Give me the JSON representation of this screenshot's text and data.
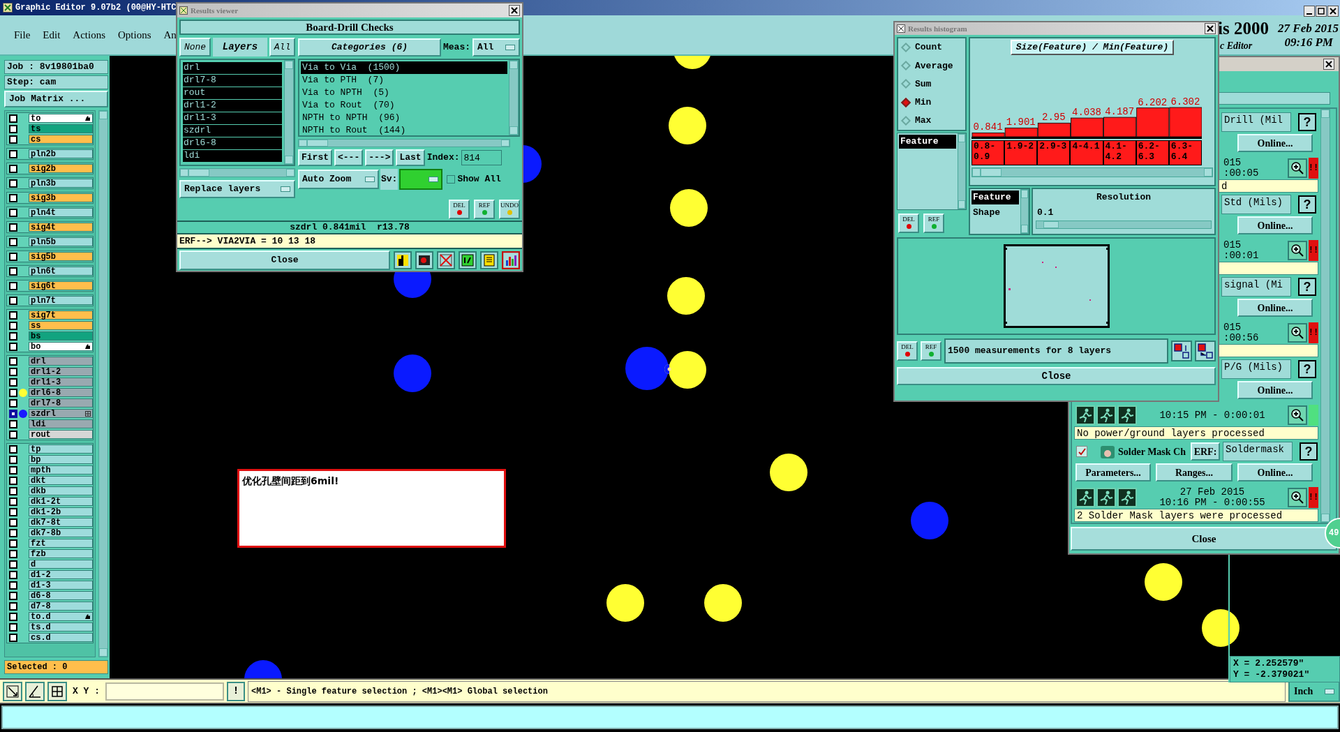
{
  "app": {
    "title": "Graphic Editor 9.07b2 (00@HY-HTC",
    "menu": [
      "File",
      "Edit",
      "Actions",
      "Options",
      "An"
    ]
  },
  "header": {
    "brand": "is 2000",
    "subtitle": "c Editor",
    "date": "27 Feb 2015",
    "time": "09:16 PM"
  },
  "job_panel": {
    "job": "Job : 8v19801ba0",
    "step": "Step: cam",
    "matrix_button": "Job Matrix ...",
    "selected_count": "Selected : 0",
    "layer_groups": [
      {
        "layers": [
          {
            "name": "to",
            "color": "#ffffff",
            "selected": false,
            "flagged": true,
            "displayed": false,
            "work": false
          },
          {
            "name": "ts",
            "color": "#12a37f",
            "selected": false,
            "flagged": false,
            "displayed": false,
            "work": false
          },
          {
            "name": "cs",
            "color": "#ffbe4c",
            "selected": false,
            "flagged": false,
            "displayed": false,
            "work": false
          }
        ]
      },
      {
        "layers": [
          {
            "name": "pln2b",
            "color": "#9edcdc",
            "selected": false,
            "flagged": false,
            "displayed": false,
            "work": false
          }
        ]
      },
      {
        "layers": [
          {
            "name": "sig2b",
            "color": "#ffbe4c",
            "selected": false,
            "flagged": false,
            "displayed": false,
            "work": false
          }
        ]
      },
      {
        "layers": [
          {
            "name": "pln3b",
            "color": "#9edcdc",
            "selected": false,
            "flagged": false,
            "displayed": false,
            "work": false
          }
        ]
      },
      {
        "layers": [
          {
            "name": "sig3b",
            "color": "#ffbe4c",
            "selected": false,
            "flagged": false,
            "displayed": false,
            "work": false
          }
        ]
      },
      {
        "layers": [
          {
            "name": "pln4t",
            "color": "#9edcdc",
            "selected": false,
            "flagged": false,
            "displayed": false,
            "work": false
          }
        ]
      },
      {
        "layers": [
          {
            "name": "sig4t",
            "color": "#ffbe4c",
            "selected": false,
            "flagged": false,
            "displayed": false,
            "work": false
          }
        ]
      },
      {
        "layers": [
          {
            "name": "pln5b",
            "color": "#9edcdc",
            "selected": false,
            "flagged": false,
            "displayed": false,
            "work": false
          }
        ]
      },
      {
        "layers": [
          {
            "name": "sig5b",
            "color": "#ffbe4c",
            "selected": false,
            "flagged": false,
            "displayed": false,
            "work": false
          }
        ]
      },
      {
        "layers": [
          {
            "name": "pln6t",
            "color": "#9edcdc",
            "selected": false,
            "flagged": false,
            "displayed": false,
            "work": false
          }
        ]
      },
      {
        "layers": [
          {
            "name": "sig6t",
            "color": "#ffbe4c",
            "selected": false,
            "flagged": false,
            "displayed": false,
            "work": false
          }
        ]
      },
      {
        "layers": [
          {
            "name": "pln7t",
            "color": "#9edcdc",
            "selected": false,
            "flagged": false,
            "displayed": false,
            "work": false
          }
        ]
      },
      {
        "layers": [
          {
            "name": "sig7t",
            "color": "#ffbe4c",
            "selected": false,
            "flagged": false,
            "displayed": false,
            "work": false
          },
          {
            "name": "ss",
            "color": "#ffbe4c",
            "selected": false,
            "flagged": false,
            "displayed": false,
            "work": false
          },
          {
            "name": "bs",
            "color": "#12a37f",
            "selected": false,
            "flagged": false,
            "displayed": false,
            "work": false
          },
          {
            "name": "bo",
            "color": "#ffffff",
            "selected": false,
            "flagged": true,
            "displayed": false,
            "work": false
          }
        ]
      },
      {
        "layers": [
          {
            "name": "drl",
            "color": "#99a9b0",
            "selected": false,
            "flagged": false,
            "displayed": false,
            "work": false
          },
          {
            "name": "drl1-2",
            "color": "#99a9b0",
            "selected": false,
            "flagged": false,
            "displayed": false,
            "work": false
          },
          {
            "name": "drl1-3",
            "color": "#99a9b0",
            "selected": false,
            "flagged": false,
            "displayed": false,
            "work": false
          },
          {
            "name": "drl6-8",
            "color": "#99a9b0",
            "selected": false,
            "flagged": false,
            "displayed": true,
            "work": false
          },
          {
            "name": "drl7-8",
            "color": "#99a9b0",
            "selected": false,
            "flagged": false,
            "displayed": false,
            "work": false
          },
          {
            "name": "szdrl",
            "color": "#99a9b0",
            "selected": true,
            "flagged": false,
            "displayed": false,
            "work": true
          },
          {
            "name": "ldi",
            "color": "#99a9b0",
            "selected": false,
            "flagged": false,
            "displayed": false,
            "work": false
          },
          {
            "name": "rout",
            "color": "#d6d6d6",
            "selected": false,
            "flagged": false,
            "displayed": false,
            "work": false
          }
        ]
      },
      {
        "layers": [
          {
            "name": "tp",
            "color": "#9edcdc",
            "selected": false,
            "flagged": false,
            "displayed": false,
            "work": false
          },
          {
            "name": "bp",
            "color": "#9edcdc",
            "selected": false,
            "flagged": false,
            "displayed": false,
            "work": false
          },
          {
            "name": "mpth",
            "color": "#9edcdc",
            "selected": false,
            "flagged": false,
            "displayed": false,
            "work": false
          },
          {
            "name": "dkt",
            "color": "#9edcdc",
            "selected": false,
            "flagged": false,
            "displayed": false,
            "work": false
          },
          {
            "name": "dkb",
            "color": "#9edcdc",
            "selected": false,
            "flagged": false,
            "displayed": false,
            "work": false
          },
          {
            "name": "dk1-2t",
            "color": "#9edcdc",
            "selected": false,
            "flagged": false,
            "displayed": false,
            "work": false
          },
          {
            "name": "dk1-2b",
            "color": "#9edcdc",
            "selected": false,
            "flagged": false,
            "displayed": false,
            "work": false
          },
          {
            "name": "dk7-8t",
            "color": "#9edcdc",
            "selected": false,
            "flagged": false,
            "displayed": false,
            "work": false
          },
          {
            "name": "dk7-8b",
            "color": "#9edcdc",
            "selected": false,
            "flagged": false,
            "displayed": false,
            "work": false
          },
          {
            "name": "fzt",
            "color": "#9edcdc",
            "selected": false,
            "flagged": false,
            "displayed": false,
            "work": false
          },
          {
            "name": "fzb",
            "color": "#9edcdc",
            "selected": false,
            "flagged": false,
            "displayed": false,
            "work": false
          },
          {
            "name": "d",
            "color": "#9edcdc",
            "selected": false,
            "flagged": false,
            "displayed": false,
            "work": false
          },
          {
            "name": "d1-2",
            "color": "#9edcdc",
            "selected": false,
            "flagged": false,
            "displayed": false,
            "work": false
          },
          {
            "name": "d1-3",
            "color": "#9edcdc",
            "selected": false,
            "flagged": false,
            "displayed": false,
            "work": false
          },
          {
            "name": "d6-8",
            "color": "#9edcdc",
            "selected": false,
            "flagged": false,
            "displayed": false,
            "work": false
          },
          {
            "name": "d7-8",
            "color": "#9edcdc",
            "selected": false,
            "flagged": false,
            "displayed": false,
            "work": false
          },
          {
            "name": "to.d",
            "color": "#9edcdc",
            "selected": false,
            "flagged": true,
            "displayed": false,
            "work": false
          },
          {
            "name": "ts.d",
            "color": "#9edcdc",
            "selected": false,
            "flagged": false,
            "displayed": false,
            "work": false
          },
          {
            "name": "cs.d",
            "color": "#9edcdc",
            "selected": false,
            "flagged": false,
            "displayed": false,
            "work": false
          }
        ]
      }
    ]
  },
  "canvas": {
    "note": "优化孔壁间距到6mil!",
    "coordinates": [
      "X = 2.252579\"",
      "Y = -2.379021\""
    ]
  },
  "results_viewer": {
    "title": "Results viewer",
    "heading": "Board-Drill Checks",
    "none_button": "None",
    "layers_label": "Layers",
    "all_button": "All",
    "layers": [
      {
        "name": "drl",
        "selected": true
      },
      {
        "name": "drl7-8",
        "selected": true
      },
      {
        "name": "rout",
        "selected": true
      },
      {
        "name": "drl1-2",
        "selected": true
      },
      {
        "name": "drl1-3",
        "selected": true
      },
      {
        "name": "szdrl",
        "selected": true
      },
      {
        "name": "drl6-8",
        "selected": true
      },
      {
        "name": "ldi",
        "selected": true
      }
    ],
    "replace_mode": "Replace layers",
    "categories_label": "Categories (6)",
    "meas_label": "Meas:",
    "meas_value": "All",
    "categories": [
      {
        "label": "Via to Via  (1500)",
        "selected": true
      },
      {
        "label": "Via to PTH  (7)",
        "selected": false
      },
      {
        "label": "Via to NPTH  (5)",
        "selected": false
      },
      {
        "label": "Via to Rout  (70)",
        "selected": false
      },
      {
        "label": "NPTH to NPTH  (96)",
        "selected": false
      },
      {
        "label": "NPTH to Rout  (144)",
        "selected": false
      }
    ],
    "nav_buttons": [
      "First",
      "<---",
      "--->",
      "Last"
    ],
    "index_label": "Index:",
    "index_value": "814",
    "zoom_mode": "Auto Zoom",
    "sv_label": "Sv:",
    "show_all": {
      "label": "Show All",
      "checked": false
    },
    "tool_buttons": [
      "DEL",
      "REF",
      "UNDO"
    ],
    "info": "szdrl 0.841mil  r13.78",
    "erf": "ERF--> VIA2VIA = 10 13 18",
    "close": "Close"
  },
  "histogram": {
    "title": "Results histogram",
    "modes": [
      {
        "label": "Count",
        "selected": false
      },
      {
        "label": "Average",
        "selected": false
      },
      {
        "label": "Sum",
        "selected": false
      },
      {
        "label": "Min",
        "selected": true
      },
      {
        "label": "Max",
        "selected": false
      }
    ],
    "feature_list": [
      {
        "label": "Feature",
        "selected": true
      }
    ],
    "side_buttons": [
      "DEL",
      "REF"
    ],
    "chart_data": {
      "type": "bar",
      "title": "Size(Feature) / Min(Feature)",
      "categories": [
        "0.8-0.9",
        "1.9-2",
        "2.9-3",
        "4-4.1",
        "4.1-4.2",
        "6.2-6.3",
        "6.3-6.4"
      ],
      "series": [
        {
          "color": "#ff1a1a",
          "values": [
            0.841,
            1.901,
            2.95,
            4.038,
            4.187,
            6.202,
            6.302
          ]
        }
      ],
      "data_labels": true
    },
    "group_by": [
      {
        "label": "Feature",
        "selected": true
      },
      {
        "label": "Shape",
        "selected": false
      }
    ],
    "resolution_label": "Resolution",
    "resolution_value": "0.1",
    "resolution_slider": {
      "level": 0.04
    },
    "bottom_buttons": [
      "DEL",
      "REF"
    ],
    "summary": "1500 measurements for 8 layers",
    "close": "Close"
  },
  "checklist": {
    "badge": "49",
    "close": "Close",
    "actions": [
      {
        "kind": "covered",
        "erf_value": "Drill (Mil",
        "help": "?",
        "online": "Online...",
        "date": "015",
        "time": ":00:05",
        "failed": true,
        "alert": "!!",
        "message": "d"
      },
      {
        "kind": "covered",
        "erf_value": "Std (Mils)",
        "help": "?",
        "online": "Online...",
        "date": "015",
        "time": ":00:01",
        "failed": true,
        "alert": "!!"
      },
      {
        "kind": "covered",
        "erf_value": "signal (Mi",
        "help": "?",
        "online": "Online...",
        "date": "015",
        "time": ":00:56",
        "failed": true,
        "alert": "!!"
      },
      {
        "kind": "half",
        "erf_value": "P/G (Mils)",
        "help": "?",
        "online": "Online...",
        "time": "10:15 PM - 0:00:01",
        "failed": false,
        "message": "No power/ground layers processed"
      },
      {
        "kind": "full",
        "checked": true,
        "name": "Solder Mask Ch",
        "erf_label": "ERF:",
        "erf_value": "Soldermask",
        "help": "?",
        "parameters": "Parameters...",
        "ranges": "Ranges...",
        "online": "Online...",
        "date": "27 Feb 2015",
        "time": "10:16 PM - 0:00:55",
        "failed": true,
        "alert": "!!",
        "message": "2 Solder Mask layers were processed"
      }
    ]
  },
  "bottom_bar": {
    "xy_label": "X Y :",
    "alert_button": "!",
    "message": "<M1> - Single feature selection ; <M1><M1> Global selection",
    "units": "Inch"
  }
}
